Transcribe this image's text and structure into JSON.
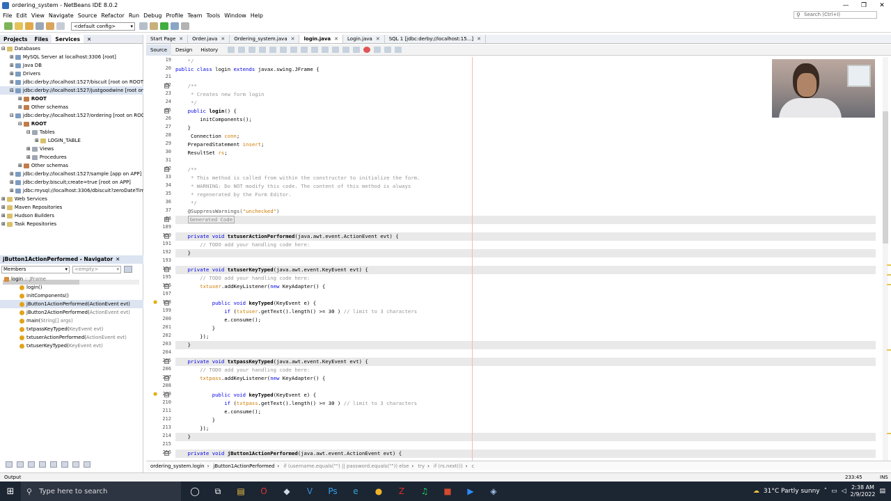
{
  "window": {
    "title": "ordering_system - NetBeans IDE 8.0.2",
    "minimize": "—",
    "maximize": "❐",
    "close": "✕"
  },
  "menu": [
    "File",
    "Edit",
    "View",
    "Navigate",
    "Source",
    "Refactor",
    "Run",
    "Debug",
    "Profile",
    "Team",
    "Tools",
    "Window",
    "Help"
  ],
  "search": {
    "placeholder": "Search (Ctrl+I)"
  },
  "toolbar": {
    "config": "<default config>"
  },
  "projects_pane": {
    "tabs": [
      "Projects",
      "Files",
      "Services"
    ],
    "close": "✕",
    "tree": [
      {
        "label": "Databases",
        "indent": 0,
        "exp": "⊟"
      },
      {
        "label": "MySQL Server at localhost:3306 [root]",
        "indent": 1,
        "exp": "⊞"
      },
      {
        "label": "Java DB",
        "indent": 1,
        "exp": "⊞"
      },
      {
        "label": "Drivers",
        "indent": 1,
        "exp": "⊞"
      },
      {
        "label": "jdbc:derby://localhost:1527/biscuit [root on ROOT]",
        "indent": 1,
        "exp": "⊞"
      },
      {
        "label": "jdbc:derby://localhost:1527/justgoodwine [root on RO",
        "indent": 1,
        "exp": "⊟",
        "selected": true
      },
      {
        "label": "ROOT",
        "indent": 2,
        "exp": "⊞",
        "bold": true
      },
      {
        "label": "Other schemas",
        "indent": 2,
        "exp": "⊞"
      },
      {
        "label": "jdbc:derby://localhost:1527/ordering [root on ROOT]",
        "indent": 1,
        "exp": "⊟"
      },
      {
        "label": "ROOT",
        "indent": 2,
        "exp": "⊟",
        "bold": true
      },
      {
        "label": "Tables",
        "indent": 3,
        "exp": "⊟"
      },
      {
        "label": "LOGIN_TABLE",
        "indent": 4,
        "exp": "⊞"
      },
      {
        "label": "Views",
        "indent": 3,
        "exp": "⊞"
      },
      {
        "label": "Procedures",
        "indent": 3,
        "exp": "⊞"
      },
      {
        "label": "Other schemas",
        "indent": 2,
        "exp": "⊞"
      },
      {
        "label": "jdbc:derby://localhost:1527/sample [app on APP]",
        "indent": 1,
        "exp": "⊞"
      },
      {
        "label": "jdbc:derby:biscuit;create=true [root on APP]",
        "indent": 1,
        "exp": "⊞"
      },
      {
        "label": "jdbc:mysql://localhost:3306/dbiscuit?zeroDateTimeBeh",
        "indent": 1,
        "exp": "⊞"
      },
      {
        "label": "Web Services",
        "indent": 0,
        "exp": "⊞"
      },
      {
        "label": "Maven Repositories",
        "indent": 0,
        "exp": "⊞"
      },
      {
        "label": "Hudson Builders",
        "indent": 0,
        "exp": "⊞"
      },
      {
        "label": "Task Repositories",
        "indent": 0,
        "exp": "⊞"
      }
    ]
  },
  "navigator": {
    "title": "jButton1ActionPerformed - Navigator",
    "close": "✕",
    "members_select": "Members",
    "empty_select": "<empty>",
    "items": [
      {
        "name": "login",
        "type": " :: JFrame",
        "indent": 0
      },
      {
        "name": "login()",
        "type": "",
        "indent": 1
      },
      {
        "name": "initComponents()",
        "type": "",
        "indent": 1
      },
      {
        "name": "jButton1ActionPerformed(ActionEvent evt)",
        "type": "",
        "indent": 1,
        "selected": true
      },
      {
        "name": "jButton2ActionPerformed(",
        "type": "ActionEvent evt)",
        "indent": 1
      },
      {
        "name": "main(",
        "type": "String[] args)",
        "indent": 1
      },
      {
        "name": "txtpassKeyTyped(",
        "type": "KeyEvent evt)",
        "indent": 1
      },
      {
        "name": "txtuserActionPerformed(",
        "type": "ActionEvent evt)",
        "indent": 1
      },
      {
        "name": "txtuserKeyTyped(",
        "type": "KeyEvent evt)",
        "indent": 1
      }
    ]
  },
  "editor": {
    "tabs": [
      {
        "label": "Start Page",
        "active": false
      },
      {
        "label": "Order.java",
        "active": false
      },
      {
        "label": "Ordering_system.java",
        "active": false
      },
      {
        "label": "login.java",
        "active": true
      },
      {
        "label": "Login.java",
        "active": false
      },
      {
        "label": "SQL 1 [jdbc:derby://localhost:15...]",
        "active": false
      }
    ],
    "tab_close": "✕",
    "views": [
      "Source",
      "Design",
      "History"
    ],
    "lines": [
      {
        "n": "19",
        "segs": [
          [
            "cm",
            "    */"
          ]
        ],
        "fold": ""
      },
      {
        "n": "20",
        "segs": [
          [
            "kw",
            "public class "
          ],
          [
            "",
            "login "
          ],
          [
            "kw",
            "extends "
          ],
          [
            "",
            "javax.swing.JFrame {"
          ]
        ],
        "fold": ""
      },
      {
        "n": "21",
        "segs": [
          [
            "",
            ""
          ]
        ],
        "fold": ""
      },
      {
        "n": "22",
        "segs": [
          [
            "cm",
            "    /**"
          ]
        ],
        "fold": "⊟"
      },
      {
        "n": "23",
        "segs": [
          [
            "cm",
            "     * Creates new form login"
          ]
        ],
        "fold": ""
      },
      {
        "n": "24",
        "segs": [
          [
            "cm",
            "     */"
          ]
        ],
        "fold": ""
      },
      {
        "n": "25",
        "segs": [
          [
            "kw",
            "    public "
          ],
          [
            "fn",
            "login"
          ],
          [
            "",
            "() {"
          ]
        ],
        "fold": "⊟"
      },
      {
        "n": "26",
        "segs": [
          [
            "",
            "        initComponents();"
          ]
        ],
        "fold": ""
      },
      {
        "n": "27",
        "segs": [
          [
            "",
            "    }"
          ]
        ],
        "fold": ""
      },
      {
        "n": "28",
        "segs": [
          [
            "",
            "     Connection "
          ],
          [
            "st",
            "conn"
          ],
          [
            "",
            ";"
          ]
        ],
        "fold": ""
      },
      {
        "n": "29",
        "segs": [
          [
            "",
            "    PreparedStatement "
          ],
          [
            "st",
            "insert"
          ],
          [
            "",
            ";"
          ]
        ],
        "fold": ""
      },
      {
        "n": "30",
        "segs": [
          [
            "",
            "    ResultSet "
          ],
          [
            "st",
            "rs"
          ],
          [
            "",
            ";"
          ]
        ],
        "fold": ""
      },
      {
        "n": "31",
        "segs": [
          [
            "",
            ""
          ]
        ],
        "fold": ""
      },
      {
        "n": "32",
        "segs": [
          [
            "cm",
            "    /**"
          ]
        ],
        "fold": "⊟"
      },
      {
        "n": "33",
        "segs": [
          [
            "cm",
            "     * This method is called from within the constructor to initialize the form."
          ]
        ],
        "fold": ""
      },
      {
        "n": "34",
        "segs": [
          [
            "cm",
            "     * WARNING: Do NOT modify this code. The content of this method is always"
          ]
        ],
        "fold": ""
      },
      {
        "n": "35",
        "segs": [
          [
            "cm",
            "     * regenerated by the Form Editor."
          ]
        ],
        "fold": ""
      },
      {
        "n": "36",
        "segs": [
          [
            "cm",
            "     */"
          ]
        ],
        "fold": ""
      },
      {
        "n": "37",
        "segs": [
          [
            "an",
            "    @SuppressWarnings("
          ],
          [
            "st",
            "\"unchecked\""
          ],
          [
            "an",
            ")"
          ]
        ],
        "fold": ""
      },
      {
        "n": "38",
        "segs": [
          [
            "",
            "    "
          ],
          [
            "gen",
            "Generated Code"
          ]
        ],
        "fold": "⊞",
        "hl": true
      },
      {
        "n": "189",
        "segs": [
          [
            "",
            ""
          ]
        ],
        "fold": ""
      },
      {
        "n": "190",
        "segs": [
          [
            "kw",
            "    private void "
          ],
          [
            "fn",
            "txtuserActionPerformed"
          ],
          [
            "",
            "(java.awt.event.ActionEvent evt) {"
          ]
        ],
        "fold": "⊟",
        "hl": true
      },
      {
        "n": "191",
        "segs": [
          [
            "cm",
            "        // TODO add your handling code here:"
          ]
        ],
        "fold": ""
      },
      {
        "n": "192",
        "segs": [
          [
            "",
            "    }"
          ]
        ],
        "fold": "",
        "hl": true
      },
      {
        "n": "193",
        "segs": [
          [
            "",
            ""
          ]
        ],
        "fold": ""
      },
      {
        "n": "194",
        "segs": [
          [
            "kw",
            "    private void "
          ],
          [
            "fn",
            "txtuserKeyTyped"
          ],
          [
            "",
            "(java.awt.event.KeyEvent evt) {"
          ]
        ],
        "fold": "⊟",
        "hl": true
      },
      {
        "n": "195",
        "segs": [
          [
            "cm",
            "        // TODO add your handling code here:"
          ]
        ],
        "fold": ""
      },
      {
        "n": "196",
        "segs": [
          [
            "st",
            "        txtuser"
          ],
          [
            "",
            ".addKeyListener("
          ],
          [
            "kw",
            "new "
          ],
          [
            "",
            "KeyAdapter() {"
          ]
        ],
        "fold": "⊟"
      },
      {
        "n": "197",
        "segs": [
          [
            "",
            ""
          ]
        ],
        "fold": ""
      },
      {
        "n": "198",
        "segs": [
          [
            "kw",
            "            public void "
          ],
          [
            "fn",
            "keyTyped"
          ],
          [
            "",
            "(KeyEvent e) {"
          ]
        ],
        "fold": "⊟"
      },
      {
        "n": "199",
        "segs": [
          [
            "kw",
            "                if "
          ],
          [
            "",
            "("
          ],
          [
            "st",
            "txtuser"
          ],
          [
            "",
            ".getText().length() >= 30 ) "
          ],
          [
            "cm",
            "// limit to 3 characters"
          ]
        ],
        "fold": ""
      },
      {
        "n": "200",
        "segs": [
          [
            "",
            "                e.consume();"
          ]
        ],
        "fold": ""
      },
      {
        "n": "201",
        "segs": [
          [
            "",
            "            }"
          ]
        ],
        "fold": ""
      },
      {
        "n": "202",
        "segs": [
          [
            "",
            "        });"
          ]
        ],
        "fold": ""
      },
      {
        "n": "203",
        "segs": [
          [
            "",
            "    }"
          ]
        ],
        "fold": "",
        "hl": true
      },
      {
        "n": "204",
        "segs": [
          [
            "",
            ""
          ]
        ],
        "fold": ""
      },
      {
        "n": "205",
        "segs": [
          [
            "kw",
            "    private void "
          ],
          [
            "fn",
            "txtpassKeyTyped"
          ],
          [
            "",
            "(java.awt.event.KeyEvent evt) {"
          ]
        ],
        "fold": "⊟",
        "hl": true
      },
      {
        "n": "206",
        "segs": [
          [
            "cm",
            "        // TODO add your handling code here:"
          ]
        ],
        "fold": ""
      },
      {
        "n": "207",
        "segs": [
          [
            "st",
            "        txtpass"
          ],
          [
            "",
            ".addKeyListener("
          ],
          [
            "kw",
            "new "
          ],
          [
            "",
            "KeyAdapter() {"
          ]
        ],
        "fold": "⊟"
      },
      {
        "n": "208",
        "segs": [
          [
            "",
            ""
          ]
        ],
        "fold": ""
      },
      {
        "n": "209",
        "segs": [
          [
            "kw",
            "            public void "
          ],
          [
            "fn",
            "keyTyped"
          ],
          [
            "",
            "(KeyEvent e) {"
          ]
        ],
        "fold": "⊟"
      },
      {
        "n": "210",
        "segs": [
          [
            "kw",
            "                if "
          ],
          [
            "",
            "("
          ],
          [
            "st",
            "txtpass"
          ],
          [
            "",
            ".getText().length() >= 30 ) "
          ],
          [
            "cm",
            "// limit to 3 characters"
          ]
        ],
        "fold": ""
      },
      {
        "n": "211",
        "segs": [
          [
            "",
            "                e.consume();"
          ]
        ],
        "fold": ""
      },
      {
        "n": "212",
        "segs": [
          [
            "",
            "            }"
          ]
        ],
        "fold": ""
      },
      {
        "n": "213",
        "segs": [
          [
            "",
            "        });"
          ]
        ],
        "fold": ""
      },
      {
        "n": "214",
        "segs": [
          [
            "",
            "    }"
          ]
        ],
        "fold": "",
        "hl": true
      },
      {
        "n": "215",
        "segs": [
          [
            "",
            ""
          ]
        ],
        "fold": ""
      },
      {
        "n": "216",
        "segs": [
          [
            "kw",
            "    private void "
          ],
          [
            "fn",
            "jButton1ActionPerformed"
          ],
          [
            "",
            "(java.awt.event.ActionEvent evt) {"
          ]
        ],
        "fold": "⊟",
        "hl": true
      }
    ],
    "breadcrumbs": [
      "ordering_system.login",
      "jButton1ActionPerformed",
      "if (username.equals(\"\") || password.equals(\"\")) else",
      "try",
      "if (rs.next())",
      "c"
    ]
  },
  "statusbar": {
    "output": "Output",
    "position": "233:45",
    "mode": "INS"
  },
  "taskbar": {
    "search": "Type here to search",
    "apps": [
      {
        "icon": "task-view-icon",
        "glyph": "◯",
        "color": "#ffffff"
      },
      {
        "icon": "widgets-icon",
        "glyph": "⧉",
        "color": "#ffffff"
      },
      {
        "icon": "file-explorer-icon",
        "glyph": "▤",
        "color": "#f0c342"
      },
      {
        "icon": "opera-icon",
        "glyph": "O",
        "color": "#e23535"
      },
      {
        "icon": "vm-icon",
        "glyph": "◆",
        "color": "#cfd8e8"
      },
      {
        "icon": "vscode-icon",
        "glyph": "V",
        "color": "#3c8fd6"
      },
      {
        "icon": "photoshop-icon",
        "glyph": "Ps",
        "color": "#2fa3f5"
      },
      {
        "icon": "edge-icon",
        "glyph": "e",
        "color": "#2fa9d6"
      },
      {
        "icon": "chrome-icon",
        "glyph": "●",
        "color": "#f0b429"
      },
      {
        "icon": "filezilla-icon",
        "glyph": "Z",
        "color": "#d9302e"
      },
      {
        "icon": "spotify-icon",
        "glyph": "♫",
        "color": "#1ed760"
      },
      {
        "icon": "app-icon",
        "glyph": "■",
        "color": "#d34a2c"
      },
      {
        "icon": "zoom-icon",
        "glyph": "▶",
        "color": "#2d8cff"
      },
      {
        "icon": "netbeans-icon",
        "glyph": "◈",
        "color": "#9fc3ea"
      }
    ],
    "weather": "31°C  Partly sunny",
    "time": "2:38 AM",
    "date": "2/9/2022"
  }
}
